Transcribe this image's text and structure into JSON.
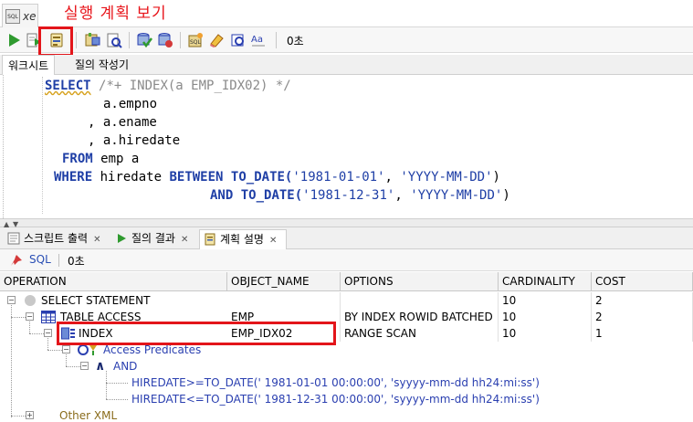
{
  "annotation": {
    "title": "실행 계획 보기"
  },
  "editor_tab": {
    "name": "xe",
    "icon": "sql-file-icon"
  },
  "toolbar": {
    "elapsed": "0초",
    "buttons": [
      "run-statement-icon",
      "run-script-icon",
      "explain-plan-icon",
      "autotrace-icon",
      "sql-tuning-advisor-icon",
      "commit-icon",
      "rollback-icon",
      "sql-history-icon",
      "clear-icon",
      "find-icon",
      "format-case-icon"
    ]
  },
  "editor_subtabs": [
    "워크시트",
    "질의 작성기"
  ],
  "code": {
    "select": "SELECT",
    "hint": "/*+ INDEX(a EMP_IDX02) */",
    "col1": "a.empno",
    "col2": ", a.ename",
    "col3": ", a.hiredate",
    "from_kw": "FROM",
    "from_rest": "emp a",
    "where_kw": "WHERE",
    "where_col": "hiredate",
    "between_kw": "BETWEEN",
    "todate1": "TO_DATE(",
    "date1": "'1981-01-01'",
    "fmt1": "'YYYY-MM-DD'",
    "and_kw": "AND",
    "todate2": "TO_DATE(",
    "date2": "'1981-12-31'",
    "fmt2": "'YYYY-MM-DD'",
    "comma": ", ",
    "close": ")"
  },
  "bottom_tabs": [
    {
      "label": "스크립트 출력",
      "icon": "script-output-icon"
    },
    {
      "label": "질의 결과",
      "icon": "query-result-icon"
    },
    {
      "label": "계획 설명",
      "icon": "explain-plan-icon"
    }
  ],
  "result_bar": {
    "sql_link": "SQL",
    "time": "0초"
  },
  "plan_table": {
    "columns": [
      "OPERATION",
      "OBJECT_NAME",
      "OPTIONS",
      "CARDINALITY",
      "COST"
    ],
    "rows": [
      {
        "operation": "SELECT STATEMENT",
        "object_name": "",
        "options": "",
        "cardinality": "10",
        "cost": "2"
      },
      {
        "operation": "TABLE ACCESS",
        "object_name": "EMP",
        "options": "BY INDEX ROWID BATCHED",
        "cardinality": "10",
        "cost": "2"
      },
      {
        "operation": "INDEX",
        "object_name": "EMP_IDX02",
        "options": "RANGE SCAN",
        "cardinality": "10",
        "cost": "1"
      }
    ],
    "predicates": {
      "label": "Access Predicates",
      "and": "AND",
      "cond1": "HIREDATE>=TO_DATE(' 1981-01-01 00:00:00', 'syyyy-mm-dd hh24:mi:ss')",
      "cond2": "HIREDATE<=TO_DATE(' 1981-12-31 00:00:00', 'syyyy-mm-dd hh24:mi:ss')"
    },
    "other_xml": "Other XML"
  },
  "colors": {
    "highlight_red": "#e3151a",
    "keyword_blue": "#1f3fa6"
  }
}
